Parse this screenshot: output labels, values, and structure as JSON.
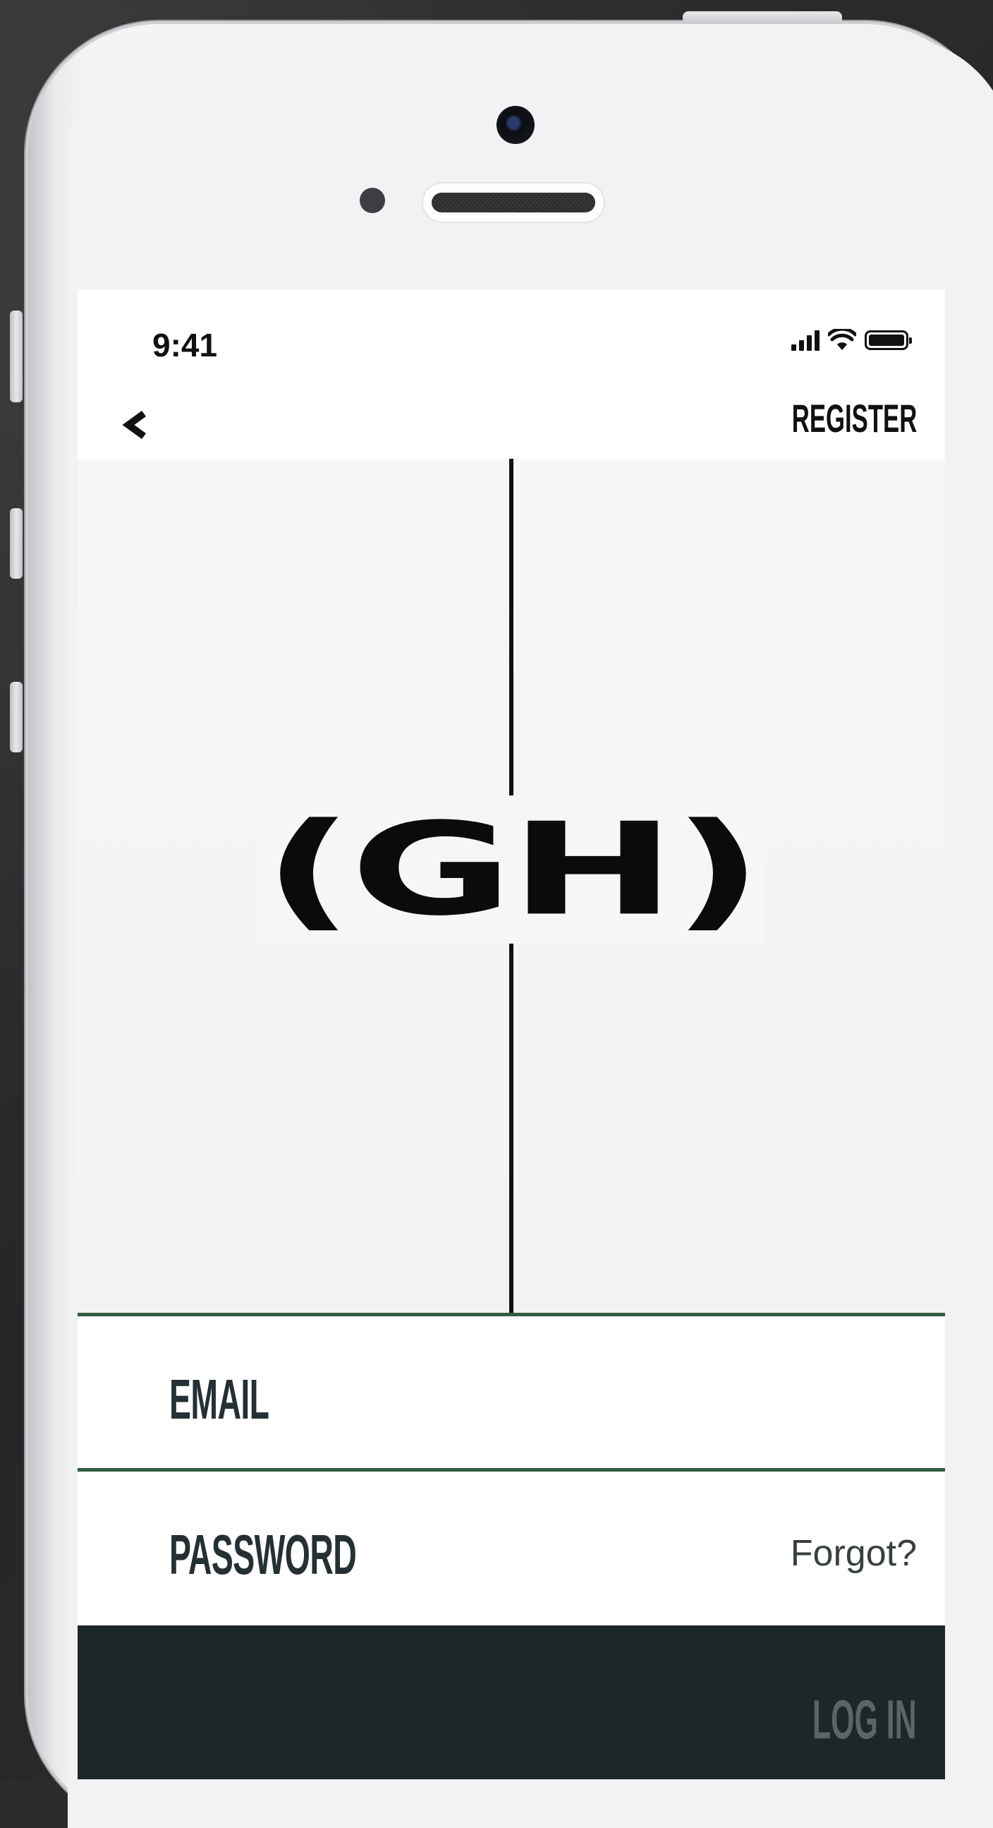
{
  "status_bar": {
    "time": "9:41",
    "icons": [
      "signal-icon",
      "wifi-icon",
      "battery-icon"
    ]
  },
  "nav": {
    "back_icon": "chevron-left-icon",
    "register_label": "REGISTER"
  },
  "hero": {
    "logo_text": "(GH)"
  },
  "form": {
    "email_label": "EMAIL",
    "password_label": "PASSWORD",
    "forgot_label": "Forgot?",
    "login_label": "LOG IN"
  },
  "colors": {
    "divider_green": "#2e5c3c",
    "login_bg": "#1c2729",
    "text_dark": "#253035"
  }
}
